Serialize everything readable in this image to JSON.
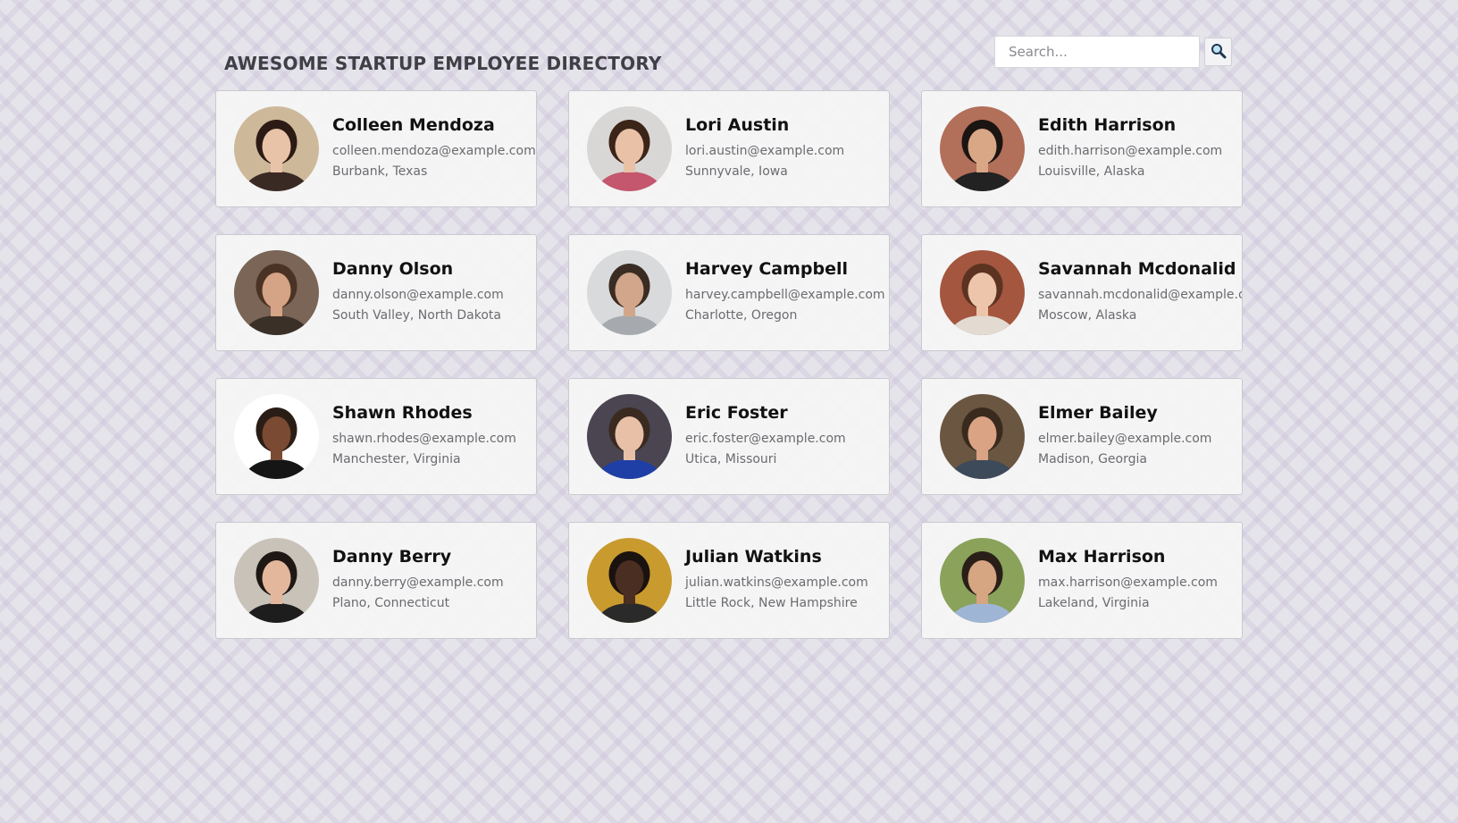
{
  "header": {
    "title": "AWESOME STARTUP EMPLOYEE DIRECTORY"
  },
  "search": {
    "placeholder": "Search...",
    "icon": "magnifier-icon"
  },
  "employees": [
    {
      "name": "Colleen Mendoza",
      "email": "colleen.mendoza@example.com",
      "location": "Burbank, Texas",
      "photo": {
        "bg": "#cdb89a",
        "hair": "#2c1b14",
        "skin": "#e9c3a8",
        "shirt": "#3a2a24"
      }
    },
    {
      "name": "Lori Austin",
      "email": "lori.austin@example.com",
      "location": "Sunnyvale, Iowa",
      "photo": {
        "bg": "#d9d7d5",
        "hair": "#3b2418",
        "skin": "#e8c1a6",
        "shirt": "#c4566e"
      }
    },
    {
      "name": "Edith Harrison",
      "email": "edith.harrison@example.com",
      "location": "Louisville, Alaska",
      "photo": {
        "bg": "#b26f5a",
        "hair": "#1a1412",
        "skin": "#d9a786",
        "shirt": "#222222"
      }
    },
    {
      "name": "Danny Olson",
      "email": "danny.olson@example.com",
      "location": "South Valley, North Dakota",
      "photo": {
        "bg": "#7a6556",
        "hair": "#4a3324",
        "skin": "#d5a385",
        "shirt": "#3b3028"
      }
    },
    {
      "name": "Harvey Campbell",
      "email": "harvey.campbell@example.com",
      "location": "Charlotte, Oregon",
      "photo": {
        "bg": "#d8dadc",
        "hair": "#3a2c22",
        "skin": "#d2a68a",
        "shirt": "#a6a9ad"
      }
    },
    {
      "name": "Savannah Mcdonalid",
      "email": "savannah.mcdonalid@example.com",
      "location": "Moscow, Alaska",
      "photo": {
        "bg": "#a4563f",
        "hair": "#5b3320",
        "skin": "#ecc5ab",
        "shirt": "#e3dbd2"
      }
    },
    {
      "name": "Shawn Rhodes",
      "email": "shawn.rhodes@example.com",
      "location": "Manchester, Virginia",
      "photo": {
        "bg": "#ffffff",
        "hair": "#2a1d16",
        "skin": "#7a4a32",
        "shirt": "#151515"
      }
    },
    {
      "name": "Eric Foster",
      "email": "eric.foster@example.com",
      "location": "Utica, Missouri",
      "photo": {
        "bg": "#4a4550",
        "hair": "#3a2a20",
        "skin": "#e8c0a8",
        "shirt": "#1f3fa6"
      }
    },
    {
      "name": "Elmer Bailey",
      "email": "elmer.bailey@example.com",
      "location": "Madison, Georgia",
      "photo": {
        "bg": "#6b5642",
        "hair": "#3a2a1e",
        "skin": "#d9a384",
        "shirt": "#3d4a5a"
      }
    },
    {
      "name": "Danny Berry",
      "email": "danny.berry@example.com",
      "location": "Plano, Connecticut",
      "photo": {
        "bg": "#c9c2b8",
        "hair": "#1e1814",
        "skin": "#e3b79c",
        "shirt": "#1d1d1d"
      }
    },
    {
      "name": "Julian Watkins",
      "email": "julian.watkins@example.com",
      "location": "Little Rock, New Hampshire",
      "photo": {
        "bg": "#c99a2e",
        "hair": "#1a120e",
        "skin": "#4a2e22",
        "shirt": "#2a2a2a"
      }
    },
    {
      "name": "Max Harrison",
      "email": "max.harrison@example.com",
      "location": "Lakeland, Virginia",
      "photo": {
        "bg": "#8aa25a",
        "hair": "#2a1f18",
        "skin": "#d6a582",
        "shirt": "#9fb5d6"
      }
    }
  ]
}
